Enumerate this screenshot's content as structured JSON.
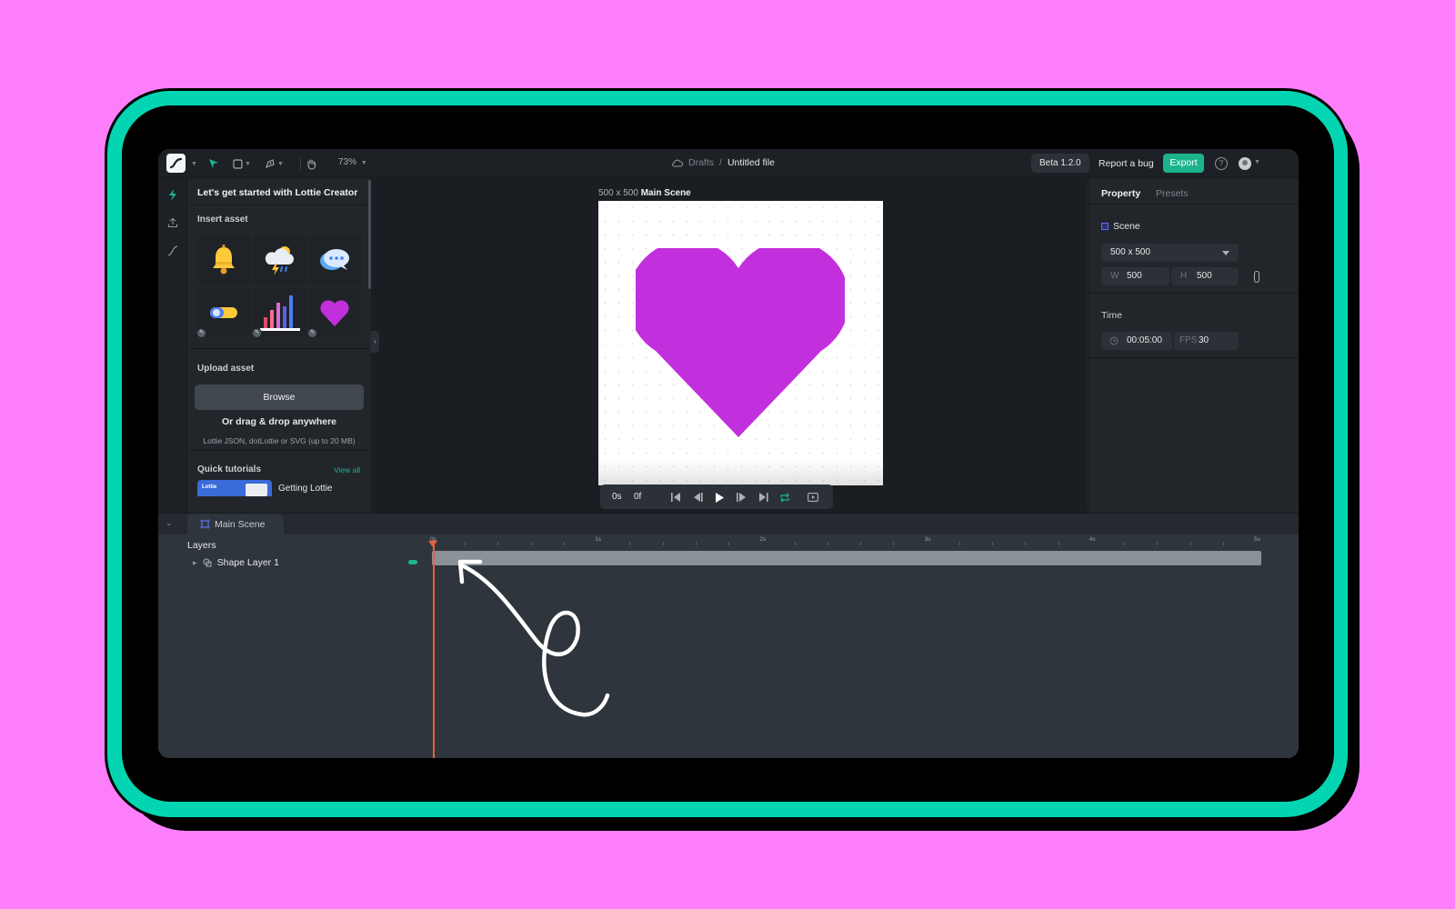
{
  "colors": {
    "background": "#fd7efb",
    "frame": "#03d5b2",
    "accent": "#1cb48c",
    "heart": "#c22fdc",
    "playhead": "#e4633b"
  },
  "toolbar": {
    "zoom": "73%",
    "breadcrumb_root": "Drafts",
    "breadcrumb_sep": "/",
    "file_name": "Untitled file",
    "beta": "Beta 1.2.0",
    "report_bug": "Report a bug",
    "export": "Export",
    "help": "?"
  },
  "left_panel": {
    "title": "Let's get started with Lottie Creator",
    "insert_asset": "Insert asset",
    "assets": [
      "bell-icon",
      "storm-cloud-icon",
      "chat-bubble-icon",
      "toggle-switch-icon",
      "bar-chart-icon",
      "heart-icon"
    ],
    "upload_asset": "Upload asset",
    "browse": "Browse",
    "drag_drop": "Or drag & drop anywhere",
    "formats": "Lottie JSON, dotLottie or SVG (up to 20 MB)",
    "quick_tutorials": "Quick tutorials",
    "view_all": "View all",
    "tutorial_thumb_text": "Lottie",
    "tutorial_title": "Getting Lottie"
  },
  "canvas": {
    "scene_size": "500 x 500",
    "scene_name": "Main Scene"
  },
  "playback": {
    "time": "0s",
    "frame": "0f"
  },
  "right_panel": {
    "tab_property": "Property",
    "tab_presets": "Presets",
    "scene_label": "Scene",
    "size_select": "500 x 500",
    "width_key": "W",
    "width": "500",
    "height_key": "H",
    "height": "500",
    "time_label": "Time",
    "duration": "00:05:00",
    "fps_key": "FPS",
    "fps": "30"
  },
  "timeline": {
    "tab": "Main Scene",
    "layers_title": "Layers",
    "layer_name": "Shape Layer 1",
    "ruler_labels": [
      "0s",
      "1s",
      "2s",
      "3s",
      "4s",
      "5s"
    ]
  }
}
